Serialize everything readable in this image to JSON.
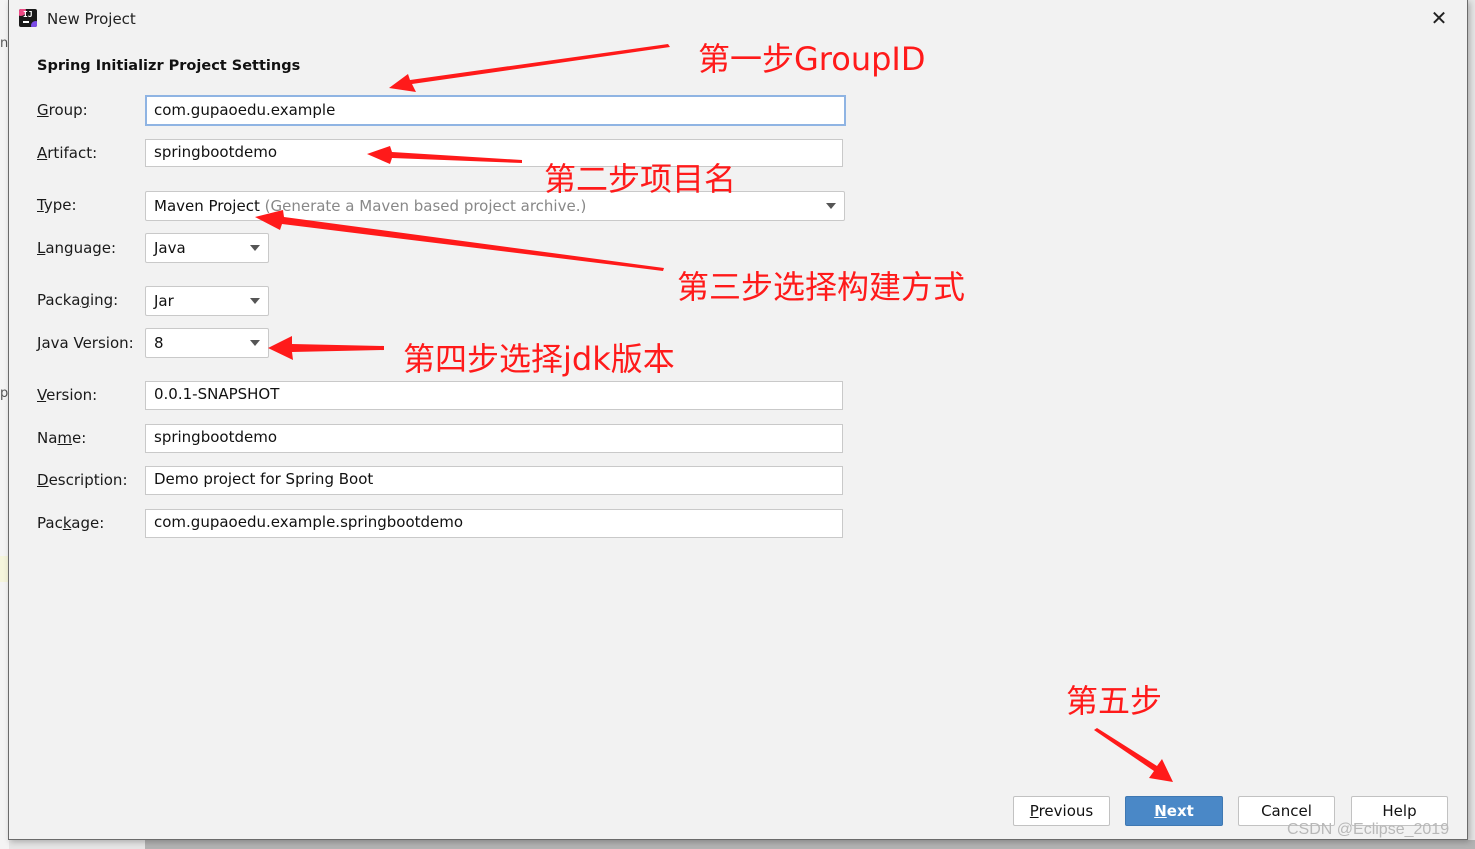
{
  "window": {
    "title": "New Project",
    "close_icon": "close-icon",
    "app_icon": "intellij-idea-icon"
  },
  "form": {
    "section_title": "Spring Initializr Project Settings",
    "fields": {
      "group": {
        "label_mnemonic": "G",
        "label_rest": "roup:",
        "value": "com.gupaoedu.example"
      },
      "artifact": {
        "label_mnemonic": "A",
        "label_rest": "rtifact:",
        "value": "springbootdemo"
      },
      "type": {
        "label_mnemonic": "T",
        "label_rest": "ype:",
        "value": "Maven Project",
        "hint": "(Generate a Maven based project archive.)"
      },
      "language": {
        "label_mnemonic": "L",
        "label_rest": "anguage:",
        "value": "Java"
      },
      "packaging": {
        "label_pre": "Packa",
        "label_mnemonic": "g",
        "label_rest": "ing:",
        "value": "Jar"
      },
      "java_version": {
        "label_mnemonic": "J",
        "label_rest": "ava Version:",
        "value": "8"
      },
      "version": {
        "label_mnemonic": "V",
        "label_rest": "ersion:",
        "value": "0.0.1-SNAPSHOT"
      },
      "name": {
        "label_pre": "Na",
        "label_mnemonic": "m",
        "label_rest": "e:",
        "value": "springbootdemo"
      },
      "description": {
        "label_mnemonic": "D",
        "label_rest": "escription:",
        "value": "Demo project for Spring Boot"
      },
      "package": {
        "label_pre": "Pac",
        "label_mnemonic": "k",
        "label_rest": "age:",
        "value": "com.gupaoedu.example.springbootdemo"
      }
    }
  },
  "buttons": {
    "previous": {
      "mnemonic": "P",
      "rest": "revious"
    },
    "next": {
      "mnemonic": "N",
      "rest": "ext"
    },
    "cancel": "Cancel",
    "help": "Help"
  },
  "annotations": {
    "step1": "第一步GroupID",
    "step2": "第二步项目名",
    "step3": "第三步选择构建方式",
    "step4": "第四步选择jdk版本",
    "step5": "第五步",
    "color": "#ff1a1a"
  },
  "watermark": "CSDN @Eclipse_2019",
  "background_fragments": [
    "ng",
    "p"
  ]
}
